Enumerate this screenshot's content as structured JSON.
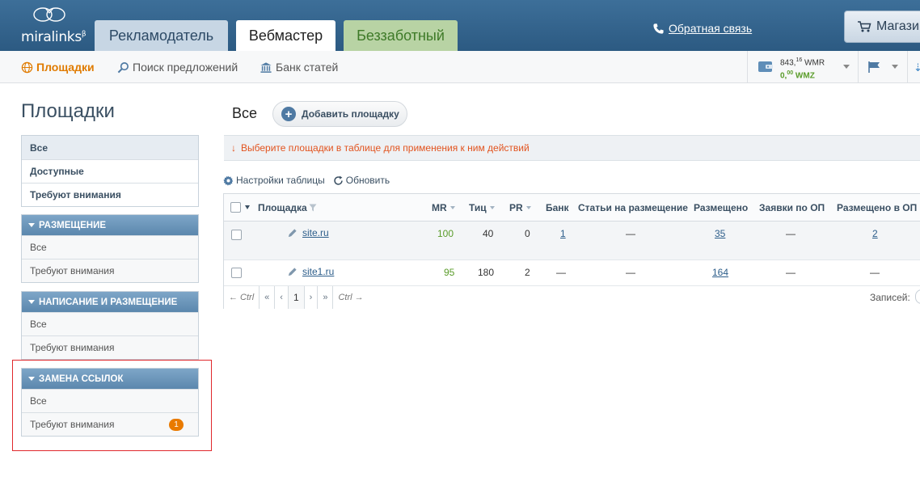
{
  "header": {
    "logo_text": "miralinks",
    "logo_sup": "β",
    "tabs": [
      {
        "label": "Рекламодатель"
      },
      {
        "label": "Вебмастер"
      },
      {
        "label": "Беззаботный"
      }
    ],
    "feedback_label": "Обратная связь",
    "shop_label": "Магазин"
  },
  "subnav": {
    "items": [
      {
        "label": "Площадки",
        "icon": "globe-icon",
        "active": true
      },
      {
        "label": "Поиск предложений",
        "icon": "search-icon"
      },
      {
        "label": "Банк статей",
        "icon": "bank-icon"
      }
    ],
    "wallet": {
      "wmr_amount": "843,",
      "wmr_cents": "16",
      "wmr_currency": " WMR",
      "wmz_amount": "0,",
      "wmz_cents": "00",
      "wmz_currency": " WMZ"
    }
  },
  "sidebar": {
    "title": "Площадки",
    "filters": [
      "Все",
      "Доступные",
      "Требуют внимания"
    ],
    "sections": [
      {
        "title": "Размещение",
        "items": [
          "Все",
          "Требуют внимания"
        ]
      },
      {
        "title": "Написание и размещение",
        "items": [
          "Все",
          "Требуют внимания"
        ]
      },
      {
        "title": "Замена ссылок",
        "items": [
          "Все",
          "Требуют внимания"
        ],
        "badge": "1"
      }
    ]
  },
  "main": {
    "title": "Все",
    "add_button": "Добавить площадку",
    "notice": "Выберите площадки в таблице для применения к ним действий",
    "tools": {
      "settings": "Настройки таблицы",
      "refresh": "Обновить"
    },
    "table": {
      "columns": [
        "Площадка",
        "MR",
        "Тиц",
        "PR",
        "Банк",
        "Статьи на размещение",
        "Размещено",
        "Заявки по ОП",
        "Размещено в ОП"
      ],
      "rows": [
        {
          "site": "site.ru",
          "mr": "100",
          "tic": "40",
          "pr": "0",
          "bank": "1",
          "articles": "—",
          "placed": "35",
          "requests": "—",
          "placed_op": "2"
        },
        {
          "site": "site1.ru",
          "mr": "95",
          "tic": "180",
          "pr": "2",
          "bank": "—",
          "articles": "—",
          "placed": "164",
          "requests": "—",
          "placed_op": "—"
        }
      ]
    },
    "pager": {
      "prev_ctrl": "← Ctrl",
      "first": "«",
      "prev": "‹",
      "page": "1",
      "next": "›",
      "last": "»",
      "next_ctrl": "Ctrl →",
      "records_label": "Записей:"
    }
  },
  "colors": {
    "header_bg": "#2c5a82",
    "active_nav": "#e07b00",
    "notice_text": "#e2531e",
    "highlight_border": "#e0282c",
    "badge_bg": "#e97a00"
  }
}
